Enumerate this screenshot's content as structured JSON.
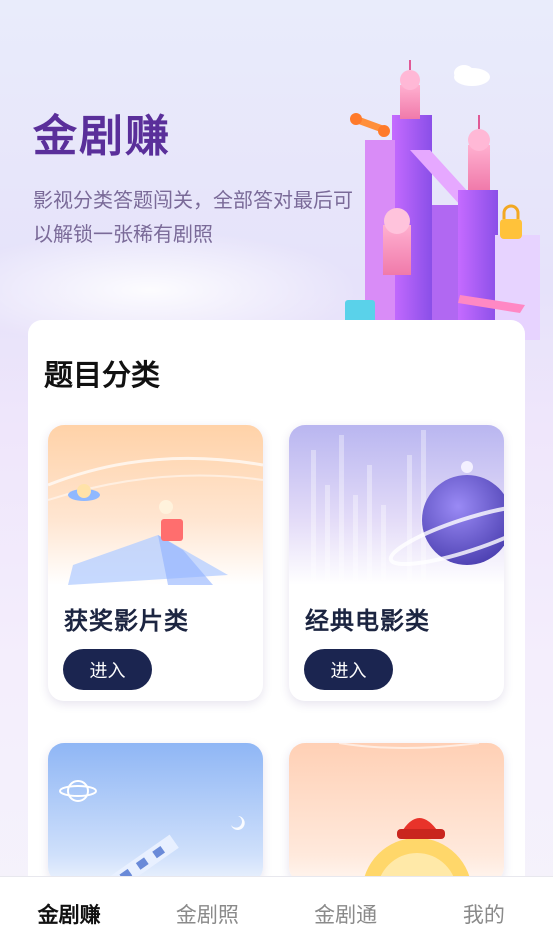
{
  "hero": {
    "title": "金剧赚",
    "description": "影视分类答题闯关，全部答对最后可以解锁一张稀有剧照"
  },
  "panel": {
    "title": "题目分类",
    "categories": [
      {
        "name": "获奖影片类",
        "button_label": "进入",
        "illustration": "ufo-planet-scene"
      },
      {
        "name": "经典电影类",
        "button_label": "进入",
        "illustration": "planet-film-strip-scene"
      },
      {
        "name": "",
        "button_label": "",
        "illustration": "saturn-film-scene"
      },
      {
        "name": "",
        "button_label": "",
        "illustration": "red-hat-medal-scene"
      }
    ]
  },
  "tabbar": {
    "tabs": [
      {
        "label": "金剧赚",
        "active": true
      },
      {
        "label": "金剧照",
        "active": false
      },
      {
        "label": "金剧通",
        "active": false
      },
      {
        "label": "我的",
        "active": false
      }
    ]
  },
  "colors": {
    "brand_title": "#5a2f9a",
    "button_bg": "#1b2550",
    "tab_active": "#111111",
    "tab_inactive": "#8a8a8a"
  }
}
